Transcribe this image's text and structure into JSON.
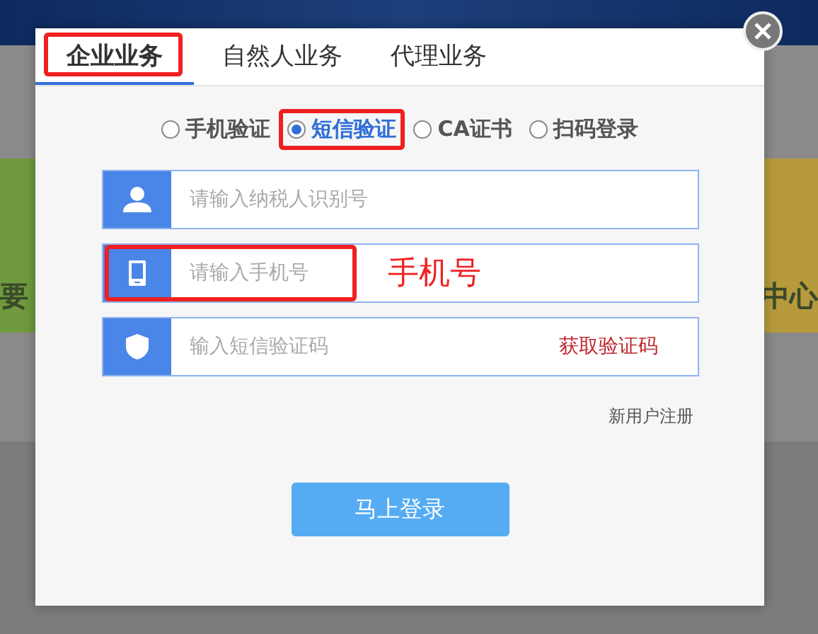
{
  "background": {
    "tiles": [
      {
        "label": "要",
        "color": "#6f9a3e"
      },
      {
        "label": "中心",
        "color": "#b69a3c"
      }
    ]
  },
  "dialog": {
    "tabs": [
      {
        "label": "企业业务",
        "selected": true,
        "highlighted": true
      },
      {
        "label": "自然人业务",
        "selected": false,
        "highlighted": false
      },
      {
        "label": "代理业务",
        "selected": false,
        "highlighted": false
      }
    ],
    "methods": [
      {
        "label": "手机验证",
        "selected": false,
        "highlighted": false
      },
      {
        "label": "短信验证",
        "selected": true,
        "highlighted": true
      },
      {
        "label": "CA证书",
        "selected": false,
        "highlighted": false
      },
      {
        "label": "扫码登录",
        "selected": false,
        "highlighted": false
      }
    ],
    "fields": [
      {
        "kind": "person",
        "placeholder": "请输入纳税人识别号",
        "highlighted": false
      },
      {
        "kind": "phone",
        "placeholder": "请输入手机号",
        "highlighted": true,
        "note": "手机号"
      },
      {
        "kind": "shield",
        "placeholder": "输入短信验证码",
        "action": "获取验证码",
        "highlighted": false
      }
    ],
    "register_link": "新用户注册",
    "login_button": "马上登录"
  }
}
